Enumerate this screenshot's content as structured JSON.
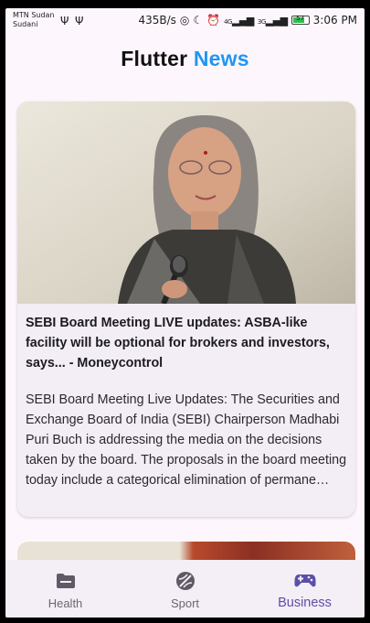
{
  "status_bar": {
    "carrier_line1": "MTN Sudan",
    "carrier_line2": "Sudani",
    "speed": "435B/s",
    "network_1": "4G",
    "network_2": "3G",
    "battery": "57",
    "time": "3:06 PM"
  },
  "app_bar": {
    "title_part1": "Flutter",
    "title_part2": "News"
  },
  "articles": [
    {
      "title": "SEBI Board Meeting LIVE updates: ASBA-like facility will be optional for brokers and investors, says... - Moneycontrol",
      "description": "SEBI Board Meeting Live Updates: The Securities and Exchange Board of India (SEBI) Chairperson Madhabi Puri Buch is addressing the media on the decisions taken by the board. The proposals in the board meeting today include a categorical elimination of permane…"
    }
  ],
  "bottom_nav": {
    "items": [
      {
        "label": "Health",
        "icon": "folder-icon",
        "active": false
      },
      {
        "label": "Sport",
        "icon": "sports-ball-icon",
        "active": false
      },
      {
        "label": "Business",
        "icon": "gamepad-icon",
        "active": true
      }
    ]
  },
  "colors": {
    "accent": "#2196f3",
    "active_nav": "#5b4fa8",
    "background": "#fdf7fd",
    "card": "#f3edf6"
  }
}
